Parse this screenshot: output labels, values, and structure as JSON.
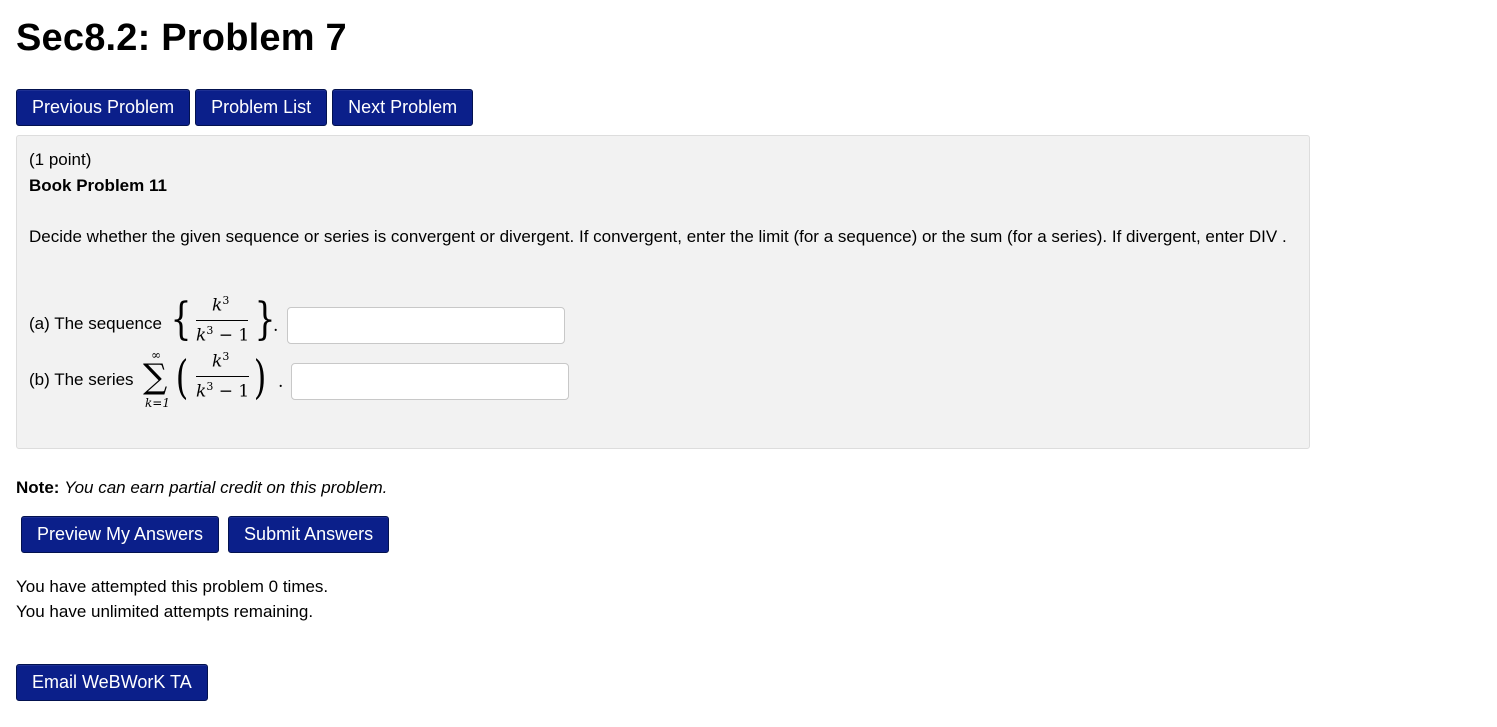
{
  "page": {
    "title": "Sec8.2: Problem 7"
  },
  "nav": {
    "previous_label": "Previous Problem",
    "list_label": "Problem List",
    "next_label": "Next Problem"
  },
  "problem": {
    "points": "(1 point)",
    "book_ref": "Book Problem 11",
    "instructions": "Decide whether the given sequence or series is convergent or divergent. If convergent, enter the limit (for a sequence) or the sum (for a series). If divergent, enter DIV .",
    "part_a": {
      "label": "(a) The sequence",
      "numerator": "k",
      "numerator_exp": "3",
      "denominator": "k",
      "denominator_exp": "3",
      "denominator_rest": " − 1",
      "period": ".",
      "answer_value": ""
    },
    "part_b": {
      "label": "(b) The series",
      "sum_upper": "∞",
      "sum_lower": "k=1",
      "numerator": "k",
      "numerator_exp": "3",
      "denominator": "k",
      "denominator_exp": "3",
      "denominator_rest": " − 1",
      "period": ".",
      "answer_value": ""
    }
  },
  "note": {
    "label": "Note:",
    "text": "You can earn partial credit on this problem."
  },
  "actions": {
    "preview_label": "Preview My Answers",
    "submit_label": "Submit Answers"
  },
  "status": {
    "attempts": "You have attempted this problem 0 times.",
    "remaining": "You have unlimited attempts remaining."
  },
  "footer": {
    "email_label": "Email WeBWorK TA"
  },
  "colors": {
    "button_bg": "#0b1f8a",
    "button_text": "#ffffff",
    "panel_bg": "#f2f2f2"
  }
}
